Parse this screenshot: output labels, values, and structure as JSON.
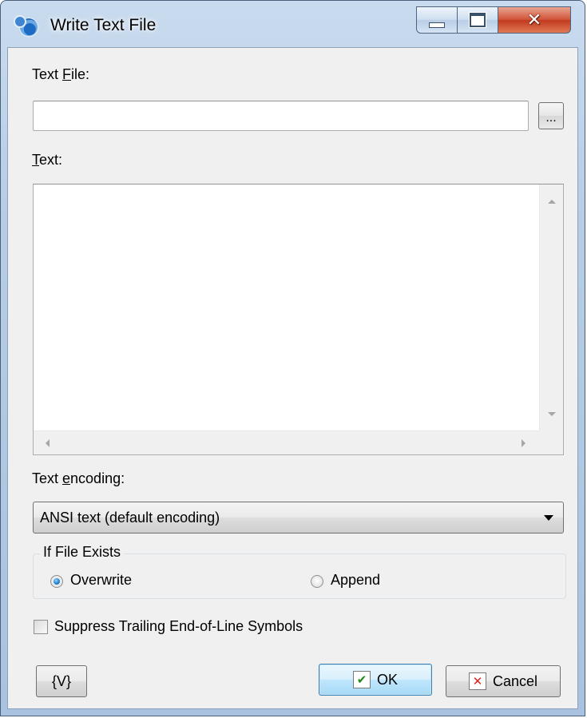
{
  "window": {
    "title": "Write Text File",
    "close_glyph": "✕"
  },
  "fields": {
    "text_file_label_pre": "Text ",
    "text_file_label_key": "F",
    "text_file_label_post": "ile:",
    "text_file_value": "",
    "browse_label": "...",
    "text_label_key": "T",
    "text_label_post": "ext:",
    "text_value": ""
  },
  "encoding": {
    "label_pre": "Text ",
    "label_key": "e",
    "label_post": "ncoding:",
    "selected": "ANSI text (default encoding)"
  },
  "if_file_exists": {
    "legend": "If File Exists",
    "options": [
      {
        "label": "Overwrite",
        "checked": true
      },
      {
        "label": "Append",
        "checked": false
      }
    ]
  },
  "suppress": {
    "label": "Suppress Trailing End-of-Line Symbols",
    "checked": false
  },
  "buttons": {
    "variables": "{V}",
    "ok": "OK",
    "cancel": "Cancel"
  },
  "icons": {
    "app": "app-gear-icon",
    "minimize": "minimize-icon",
    "maximize": "maximize-icon",
    "close": "close-icon",
    "ok": "checkmark-icon",
    "cancel": "x-icon"
  }
}
